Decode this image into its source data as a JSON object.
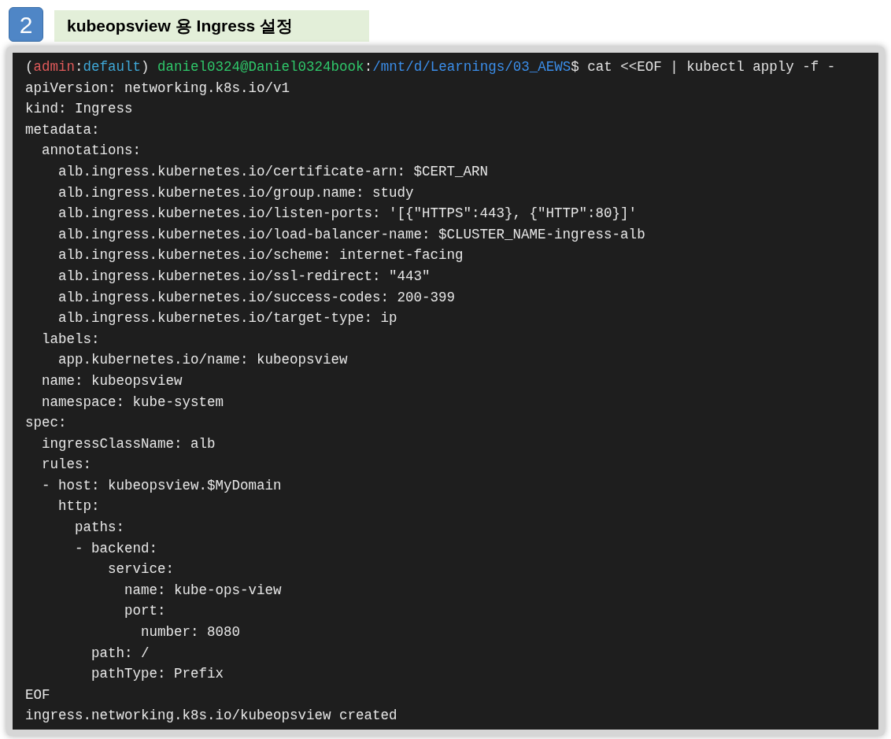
{
  "step": {
    "number": "2",
    "title": "kubeopsview 용 Ingress 설정"
  },
  "terminal": {
    "prompt": [
      {
        "text": "(",
        "color": "#e0e0e0"
      },
      {
        "text": "admin",
        "color": "#e05a5a"
      },
      {
        "text": ":",
        "color": "#e0e0e0"
      },
      {
        "text": "default",
        "color": "#3fa8d8"
      },
      {
        "text": ") ",
        "color": "#e0e0e0"
      },
      {
        "text": "daniel0324@Daniel0324book",
        "color": "#2fc76a"
      },
      {
        "text": ":",
        "color": "#e0e0e0"
      },
      {
        "text": "/mnt/d/Learnings/03_AEWS",
        "color": "#3b8eea"
      },
      {
        "text": "$ cat <<EOF | kubectl apply -f -",
        "color": "#e0e0e0"
      }
    ],
    "lines": [
      "apiVersion: networking.k8s.io/v1",
      "kind: Ingress",
      "metadata:",
      "  annotations:",
      "    alb.ingress.kubernetes.io/certificate-arn: $CERT_ARN",
      "    alb.ingress.kubernetes.io/group.name: study",
      "    alb.ingress.kubernetes.io/listen-ports: '[{\"HTTPS\":443}, {\"HTTP\":80}]'",
      "    alb.ingress.kubernetes.io/load-balancer-name: $CLUSTER_NAME-ingress-alb",
      "    alb.ingress.kubernetes.io/scheme: internet-facing",
      "    alb.ingress.kubernetes.io/ssl-redirect: \"443\"",
      "    alb.ingress.kubernetes.io/success-codes: 200-399",
      "    alb.ingress.kubernetes.io/target-type: ip",
      "  labels:",
      "    app.kubernetes.io/name: kubeopsview",
      "  name: kubeopsview",
      "  namespace: kube-system",
      "spec:",
      "  ingressClassName: alb",
      "  rules:",
      "  - host: kubeopsview.$MyDomain",
      "    http:",
      "      paths:",
      "      - backend:",
      "          service:",
      "            name: kube-ops-view",
      "            port:",
      "              number: 8080",
      "        path: /",
      "        pathType: Prefix",
      "EOF",
      "ingress.networking.k8s.io/kubeopsview created"
    ]
  }
}
